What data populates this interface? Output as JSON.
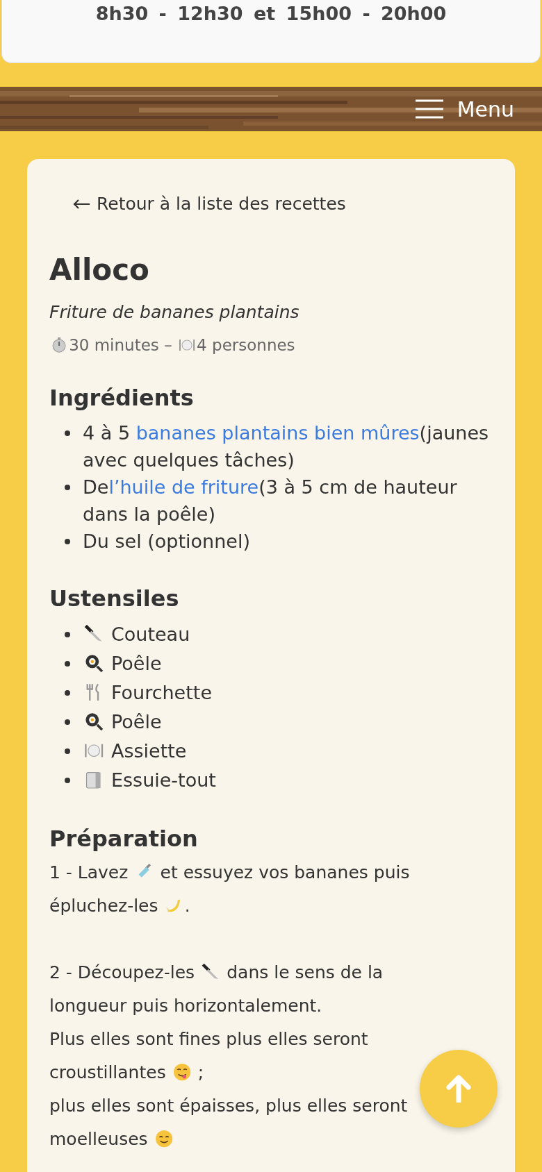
{
  "hours": "8h30 - 12h30 et 15h00 - 20h00",
  "nav": {
    "menu_label": "Menu"
  },
  "back_link": "Retour à la liste des recettes",
  "recipe": {
    "title": "Alloco",
    "subtitle": "Friture de bananes plantains",
    "duration": "30 minutes – ",
    "servings": "4 personnes"
  },
  "ingredients": {
    "heading": "Ingrédients",
    "items": [
      {
        "before": "4 à 5 ",
        "link": "bananes plantains bien mûres",
        "after": "(jaunes avec quelques tâches)"
      },
      {
        "before": "De",
        "link": "l’huile de friture",
        "after": "(3 à 5 cm de hauteur dans la poêle)"
      },
      {
        "before": "Du sel (optionnel)"
      }
    ]
  },
  "utensils": {
    "heading": "Ustensiles",
    "items": [
      "Couteau",
      "Poêle",
      "Fourchette",
      "Poêle",
      "Assiette",
      "Essuie-tout"
    ]
  },
  "preparation": {
    "heading": "Préparation",
    "paragraphs": [
      [
        [
          "1 - Lavez ",
          " et essuyez vos bananes puis épluchez-les ",
          "."
        ]
      ],
      [
        [
          "2 - Découpez-les ",
          " dans le sens de la longueur puis horizontalement."
        ],
        [
          "Plus elles sont fines plus elles seront croustillantes ",
          " ;"
        ],
        [
          "plus elles sont épaisses, plus elles seront moelleuses "
        ]
      ]
    ]
  }
}
